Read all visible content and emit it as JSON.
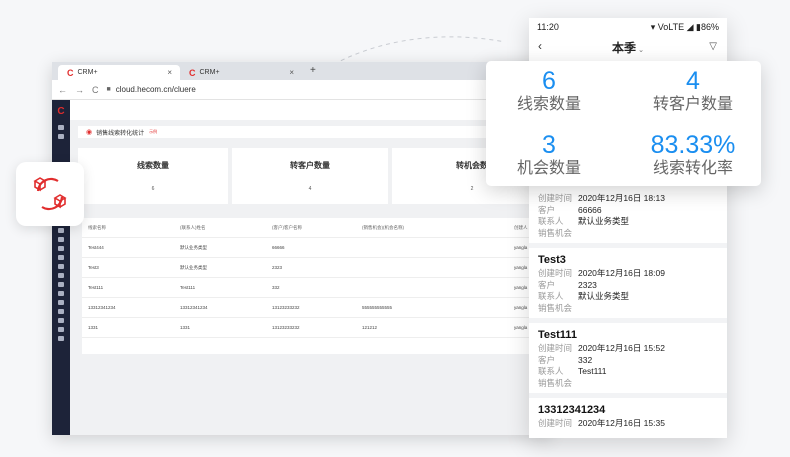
{
  "browser": {
    "tabs": [
      {
        "label": "CRM+",
        "close": "×"
      },
      {
        "label": "CRM+",
        "close": "×"
      }
    ],
    "new_tab": "+",
    "nav": {
      "back": "←",
      "forward": "→",
      "reload": "C"
    },
    "url": "cloud.hecom.cn/cluere"
  },
  "crm": {
    "sidebar_logo": "C",
    "report_title": "销售线索转化统计",
    "report_tag": "示例",
    "stats": [
      {
        "label": "线索数量",
        "value": "6"
      },
      {
        "label": "转客户数量",
        "value": "4"
      },
      {
        "label": "转机会数",
        "value": "2"
      }
    ],
    "table": {
      "headers": [
        "线索名称",
        "(联系人)姓名",
        "(客户)客户名称",
        "(销售机会)(机会名称)",
        "创建人"
      ],
      "rows": [
        [
          "Test444",
          "默认业务类型",
          "66666",
          "",
          "yangla"
        ],
        [
          "Test3",
          "默认业务类型",
          "2323",
          "",
          "yangla"
        ],
        [
          "Test111",
          "Test111",
          "332",
          "",
          "yangla"
        ],
        [
          "13312341234",
          "13312341234",
          "13123233232",
          "555555555555",
          "yangla"
        ],
        [
          "1331",
          "1331",
          "13123233232",
          "121212",
          "yangla"
        ]
      ]
    }
  },
  "phone": {
    "time": "11:20",
    "status_icons": "▾ VoLTE ◢ ▮86%",
    "back": "‹",
    "title": "本季",
    "title_chevron": "⌄",
    "filter": "▽",
    "items": [
      {
        "name": "",
        "created_label": "创建时间",
        "created": "2020年12月16日 18:13",
        "customer_label": "客户",
        "customer": "66666",
        "contact_label": "联系人",
        "contact": "默认业务类型",
        "opp_label": "销售机会",
        "opp": ""
      },
      {
        "name": "Test3",
        "created_label": "创建时间",
        "created": "2020年12月16日 18:09",
        "customer_label": "客户",
        "customer": "2323",
        "contact_label": "联系人",
        "contact": "默认业务类型",
        "opp_label": "销售机会",
        "opp": ""
      },
      {
        "name": "Test111",
        "created_label": "创建时间",
        "created": "2020年12月16日 15:52",
        "customer_label": "客户",
        "customer": "332",
        "contact_label": "联系人",
        "contact": "Test111",
        "opp_label": "销售机会",
        "opp": ""
      },
      {
        "name": "13312341234",
        "created_label": "创建时间",
        "created": "2020年12月16日 15:35"
      }
    ]
  },
  "summary": [
    {
      "value": "6",
      "label": "线索数量"
    },
    {
      "value": "4",
      "label": "转客户数量"
    },
    {
      "value": "3",
      "label": "机会数量"
    },
    {
      "value": "83.33%",
      "label": "线索转化率"
    }
  ],
  "colors": {
    "accent_blue": "#1a8ef0",
    "brand_red": "#e12d2d",
    "sidebar_navy": "#1d2339"
  }
}
